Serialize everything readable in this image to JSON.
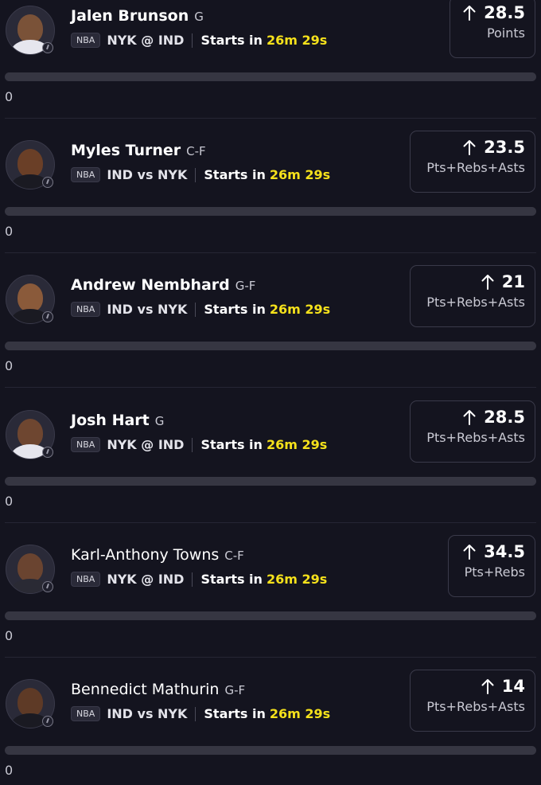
{
  "colors": {
    "background": "#14141f",
    "countdown": "#f5e11b",
    "progress_track": "#363642",
    "card_border": "#3a3a4a"
  },
  "rows": [
    {
      "name": "Jalen Brunson",
      "name_weight": "bold",
      "position": "G",
      "league": "NBA",
      "matchup": "NYK @ IND",
      "starts_label": "Starts in",
      "countdown": "26m 29s",
      "direction_icon": "arrow-up-icon",
      "line": "28.5",
      "stat": "Points",
      "progress_value": "0",
      "progress_fraction": 0,
      "avatar_skin": "#7a5238",
      "avatar_jersey": "#e6e6ee"
    },
    {
      "name": "Myles Turner",
      "name_weight": "bold",
      "position": "C-F",
      "league": "NBA",
      "matchup": "IND vs NYK",
      "starts_label": "Starts in",
      "countdown": "26m 29s",
      "direction_icon": "arrow-up-icon",
      "line": "23.5",
      "stat": "Pts+Rebs+Asts",
      "progress_value": "0",
      "progress_fraction": 0,
      "avatar_skin": "#6a3f27",
      "avatar_jersey": "#1a1a22"
    },
    {
      "name": "Andrew Nembhard",
      "name_weight": "bold",
      "position": "G-F",
      "league": "NBA",
      "matchup": "IND vs NYK",
      "starts_label": "Starts in",
      "countdown": "26m 29s",
      "direction_icon": "arrow-up-icon",
      "line": "21",
      "stat": "Pts+Rebs+Asts",
      "progress_value": "0",
      "progress_fraction": 0,
      "avatar_skin": "#8a5a3a",
      "avatar_jersey": "#1a1a22"
    },
    {
      "name": "Josh Hart",
      "name_weight": "bold",
      "position": "G",
      "league": "NBA",
      "matchup": "NYK @ IND",
      "starts_label": "Starts in",
      "countdown": "26m 29s",
      "direction_icon": "arrow-up-icon",
      "line": "28.5",
      "stat": "Pts+Rebs+Asts",
      "progress_value": "0",
      "progress_fraction": 0,
      "avatar_skin": "#6e4630",
      "avatar_jersey": "#e6e6ee"
    },
    {
      "name": "Karl-Anthony Towns",
      "name_weight": "normal",
      "position": "C-F",
      "league": "NBA",
      "matchup": "NYK @ IND",
      "starts_label": "Starts in",
      "countdown": "26m 29s",
      "direction_icon": "arrow-up-icon",
      "line": "34.5",
      "stat": "Pts+Rebs",
      "progress_value": "0",
      "progress_fraction": 0,
      "avatar_skin": "#6a4430",
      "avatar_jersey": "#2a2a34"
    },
    {
      "name": "Bennedict Mathurin",
      "name_weight": "normal",
      "position": "G-F",
      "league": "NBA",
      "matchup": "IND vs NYK",
      "starts_label": "Starts in",
      "countdown": "26m 29s",
      "direction_icon": "arrow-up-icon",
      "line": "14",
      "stat": "Pts+Rebs+Asts",
      "progress_value": "0",
      "progress_fraction": 0,
      "avatar_skin": "#5e3a26",
      "avatar_jersey": "#1a1a22"
    }
  ]
}
